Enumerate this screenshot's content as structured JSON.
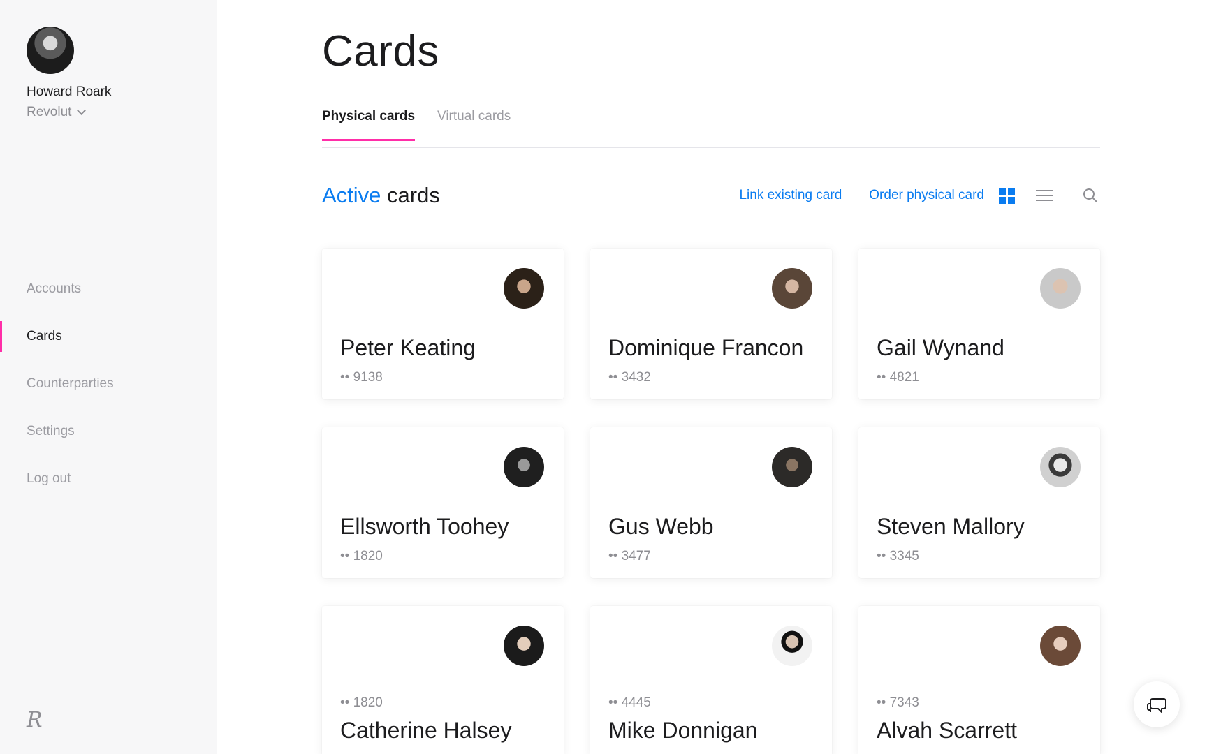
{
  "user": {
    "name": "Howard Roark",
    "organization": "Revolut"
  },
  "nav": [
    "Accounts",
    "Cards",
    "Counterparties",
    "Settings",
    "Log out"
  ],
  "nav_active": "Cards",
  "page": {
    "title": "Cards",
    "tabs": [
      "Physical cards",
      "Virtual cards"
    ],
    "active_tab": "Physical cards"
  },
  "section": {
    "title_accent": "Active",
    "title_rest": " cards",
    "link_existing": "Link existing card",
    "order_physical": "Order physical card"
  },
  "cards": [
    {
      "name": "Peter Keating",
      "number": "•• 9138"
    },
    {
      "name": "Dominique Francon",
      "number": "•• 3432"
    },
    {
      "name": "Gail Wynand",
      "number": "•• 4821"
    },
    {
      "name": "Ellsworth Toohey",
      "number": "•• 1820"
    },
    {
      "name": "Gus Webb",
      "number": "•• 3477"
    },
    {
      "name": "Steven Mallory",
      "number": "•• 3345"
    },
    {
      "name": "Catherine Halsey",
      "number": "•• 1820"
    },
    {
      "name": "Mike Donnigan",
      "number": "•• 4445"
    },
    {
      "name": "Alvah Scarrett",
      "number": "•• 7343"
    }
  ],
  "colors": {
    "accent": "#0a7cf0",
    "highlight": "#ff2ea8",
    "muted": "#8e8e93"
  },
  "icons": [
    "grid-view-icon",
    "list-view-icon",
    "search-icon",
    "chat-icon",
    "chevron-down-icon",
    "revolut-logo-icon"
  ]
}
